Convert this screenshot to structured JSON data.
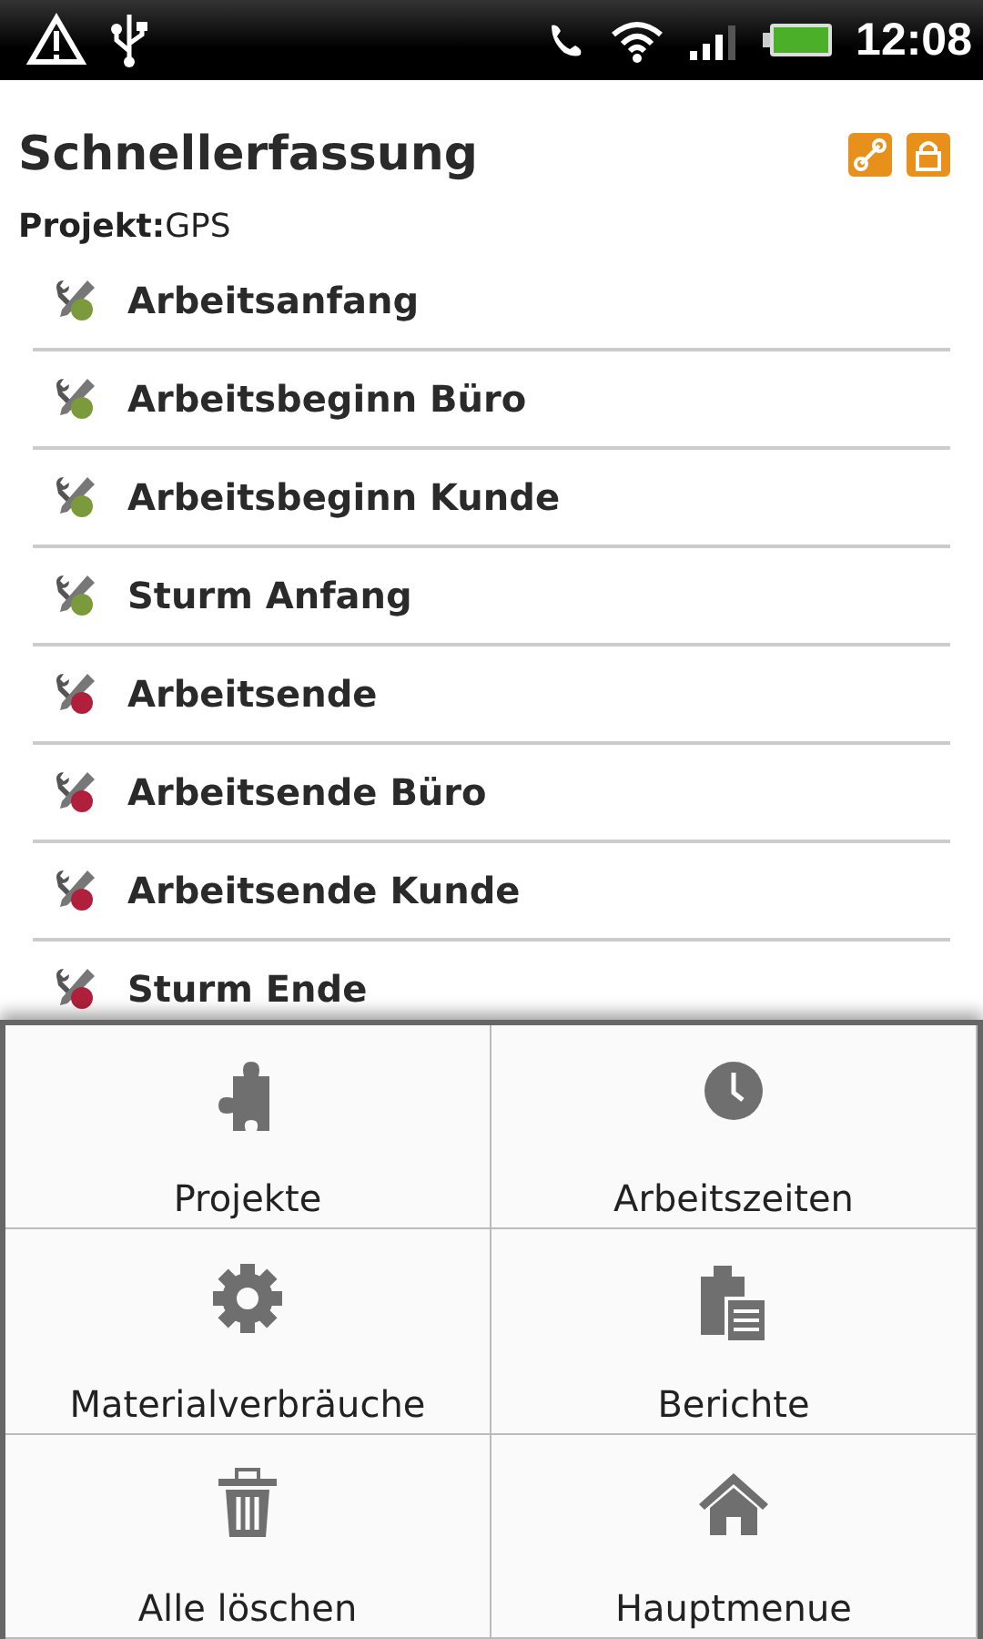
{
  "status_bar": {
    "time": "12:08"
  },
  "header": {
    "title": "Schnellerfassung",
    "project_label": "Projekt:",
    "project_value": "GPS"
  },
  "entries": [
    {
      "label": "Arbeitsanfang",
      "color": "#7a9a3c"
    },
    {
      "label": "Arbeitsbeginn Büro",
      "color": "#7a9a3c"
    },
    {
      "label": "Arbeitsbeginn Kunde",
      "color": "#7a9a3c"
    },
    {
      "label": "Sturm Anfang",
      "color": "#7a9a3c"
    },
    {
      "label": "Arbeitsende",
      "color": "#b0203c"
    },
    {
      "label": "Arbeitsende Büro",
      "color": "#b0203c"
    },
    {
      "label": "Arbeitsende Kunde",
      "color": "#b0203c"
    },
    {
      "label": "Sturm Ende",
      "color": "#b0203c"
    }
  ],
  "menu": [
    {
      "label": "Projekte",
      "kind": "puzzle"
    },
    {
      "label": "Arbeitszeiten",
      "kind": "clock"
    },
    {
      "label": "Materialverbräuche",
      "kind": "gear"
    },
    {
      "label": "Berichte",
      "kind": "clipboard"
    },
    {
      "label": "Alle löschen",
      "kind": "trash"
    },
    {
      "label": "Hauptmenue",
      "kind": "home"
    }
  ]
}
